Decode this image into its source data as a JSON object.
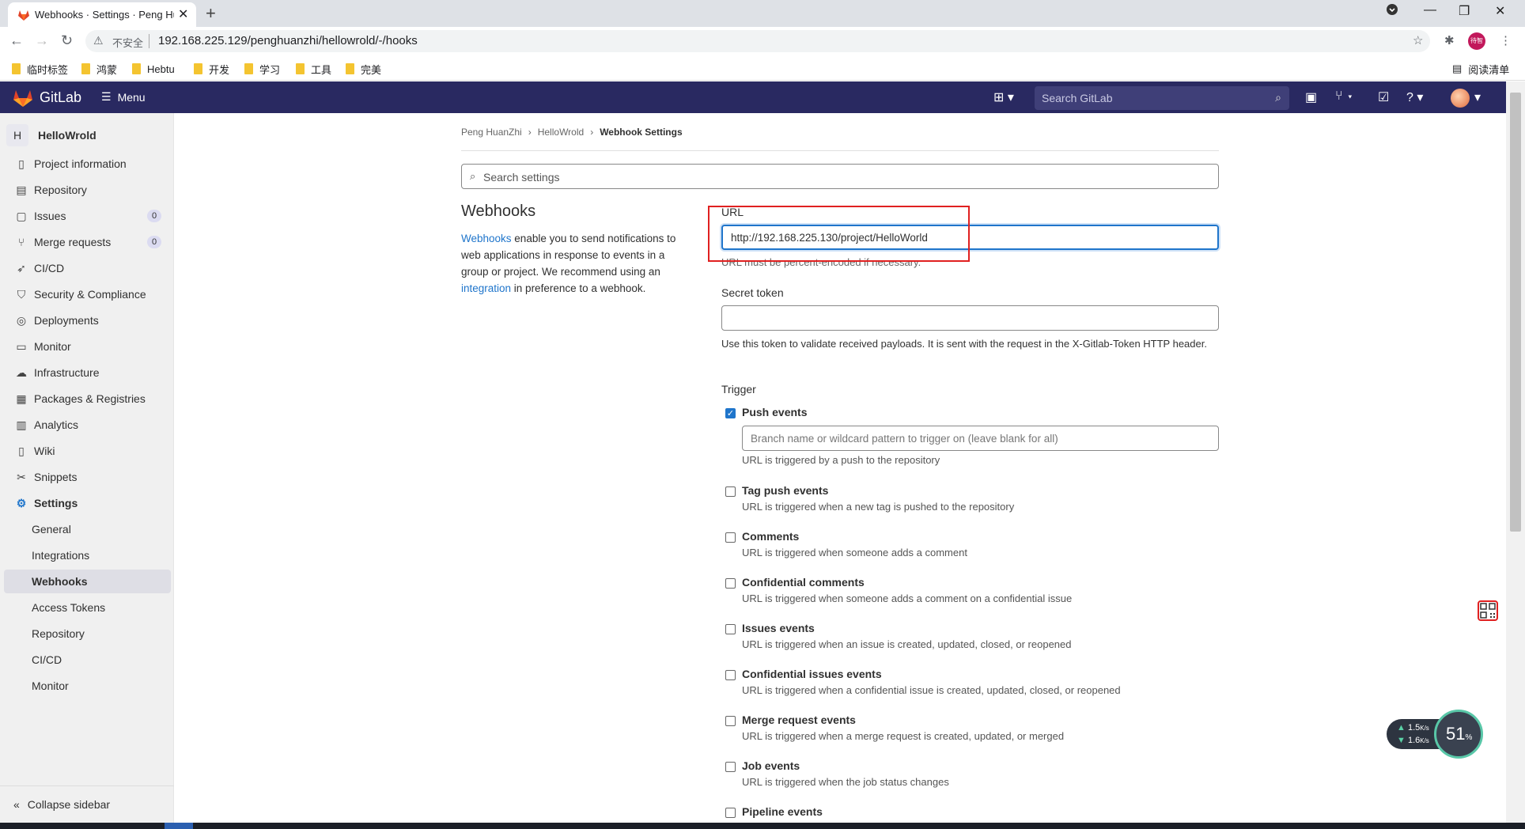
{
  "browser": {
    "tab_title": "Webhooks · Settings · Peng Hu",
    "insecure_label": "不安全",
    "url": "192.168.225.129/penghuanzhi/hellowrold/-/hooks",
    "profile_label": "待智",
    "bookmarks": [
      "临时标签",
      "鸿蒙",
      "Hebtu",
      "开发",
      "学习",
      "工具",
      "完美"
    ],
    "reading_list": "阅读清单"
  },
  "topbar": {
    "brand": "GitLab",
    "menu": "Menu",
    "search_placeholder": "Search GitLab"
  },
  "sidebar": {
    "project_initial": "H",
    "project_name": "HelloWrold",
    "items": [
      {
        "label": "Project information",
        "icon": "info-icon"
      },
      {
        "label": "Repository",
        "icon": "doc-icon"
      },
      {
        "label": "Issues",
        "icon": "issues-icon",
        "badge": "0"
      },
      {
        "label": "Merge requests",
        "icon": "merge-icon",
        "badge": "0"
      },
      {
        "label": "CI/CD",
        "icon": "rocket-icon"
      },
      {
        "label": "Security & Compliance",
        "icon": "shield-icon"
      },
      {
        "label": "Deployments",
        "icon": "deploy-icon"
      },
      {
        "label": "Monitor",
        "icon": "monitor-icon"
      },
      {
        "label": "Infrastructure",
        "icon": "cloud-icon"
      },
      {
        "label": "Packages & Registries",
        "icon": "package-icon"
      },
      {
        "label": "Analytics",
        "icon": "chart-icon"
      },
      {
        "label": "Wiki",
        "icon": "book-icon"
      },
      {
        "label": "Snippets",
        "icon": "scissors-icon"
      },
      {
        "label": "Settings",
        "icon": "gear-icon"
      }
    ],
    "settings_sub": [
      "General",
      "Integrations",
      "Webhooks",
      "Access Tokens",
      "Repository",
      "CI/CD",
      "Monitor"
    ],
    "collapse": "Collapse sidebar"
  },
  "breadcrumb": [
    "Peng HuanZhi",
    "HelloWrold",
    "Webhook Settings"
  ],
  "settings_search_placeholder": "Search settings",
  "webhooks": {
    "title": "Webhooks",
    "desc_link1": "Webhooks",
    "desc_part1": " enable you to send notifications to web applications in response to events in a group or project. We recommend using an ",
    "desc_link2": "integration",
    "desc_part2": " in preference to a webhook."
  },
  "form": {
    "url_label": "URL",
    "url_value": "http://192.168.225.130/project/HelloWorld",
    "url_hint": "URL must be percent-encoded if necessary.",
    "token_label": "Secret token",
    "token_value": "",
    "token_hint": "Use this token to validate received payloads. It is sent with the request in the X-Gitlab-Token HTTP header.",
    "trigger_label": "Trigger",
    "branch_placeholder": "Branch name or wildcard pattern to trigger on (leave blank for all)",
    "triggers": [
      {
        "name": "Push events",
        "desc": "URL is triggered by a push to the repository",
        "checked": true
      },
      {
        "name": "Tag push events",
        "desc": "URL is triggered when a new tag is pushed to the repository",
        "checked": false
      },
      {
        "name": "Comments",
        "desc": "URL is triggered when someone adds a comment",
        "checked": false
      },
      {
        "name": "Confidential comments",
        "desc": "URL is triggered when someone adds a comment on a confidential issue",
        "checked": false
      },
      {
        "name": "Issues events",
        "desc": "URL is triggered when an issue is created, updated, closed, or reopened",
        "checked": false
      },
      {
        "name": "Confidential issues events",
        "desc": "URL is triggered when a confidential issue is created, updated, closed, or reopened",
        "checked": false
      },
      {
        "name": "Merge request events",
        "desc": "URL is triggered when a merge request is created, updated, or merged",
        "checked": false
      },
      {
        "name": "Job events",
        "desc": "URL is triggered when the job status changes",
        "checked": false
      },
      {
        "name": "Pipeline events",
        "desc": "",
        "checked": false
      }
    ]
  },
  "net_monitor": {
    "up": "1.5",
    "down": "1.6",
    "unit": "K/s",
    "percent": "51",
    "percent_sym": "%"
  }
}
